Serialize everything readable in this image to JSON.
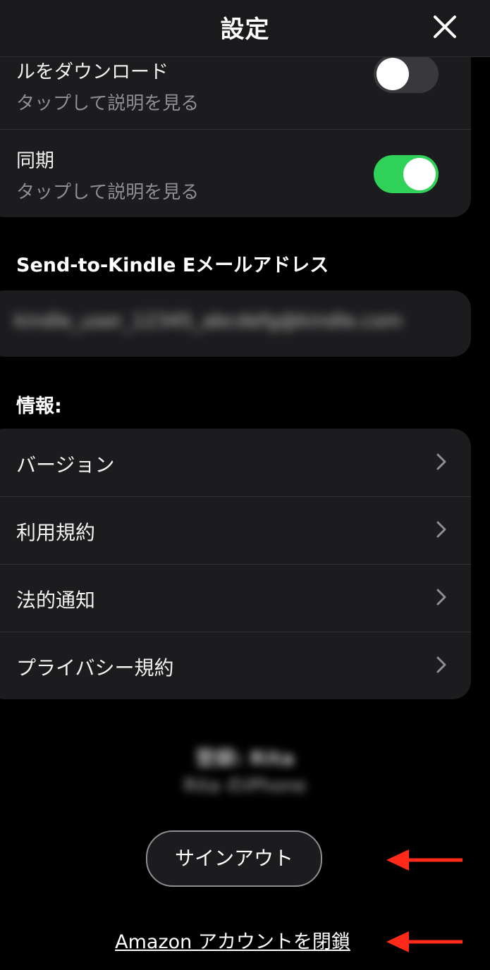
{
  "header": {
    "title": "設定",
    "close_icon": "close-icon"
  },
  "settings_card": {
    "rows": [
      {
        "title": "ルをダウンロード",
        "subtitle": "タップして説明を見る",
        "toggle": false
      },
      {
        "title": "同期",
        "subtitle": "タップして説明を見る",
        "toggle": true
      }
    ]
  },
  "email_section": {
    "title": "Send-to-Kindle Eメールアドレス",
    "value": "kindle_user_12345_abcdefg@kindle.com"
  },
  "info_section": {
    "title": "情報:",
    "items": [
      {
        "label": "バージョン"
      },
      {
        "label": "利用規約"
      },
      {
        "label": "法的通知"
      },
      {
        "label": "プライバシー規約"
      }
    ]
  },
  "device_info": {
    "line1": "登録: Rita",
    "line2": "Rita のiPhone"
  },
  "actions": {
    "signout_label": "サインアウト",
    "close_account_label": "Amazon アカウントを閉鎖"
  },
  "colors": {
    "toggle_on": "#30d158",
    "toggle_off": "#39393d",
    "arrow": "#ff2a1a",
    "card": "#1c1c1e"
  }
}
